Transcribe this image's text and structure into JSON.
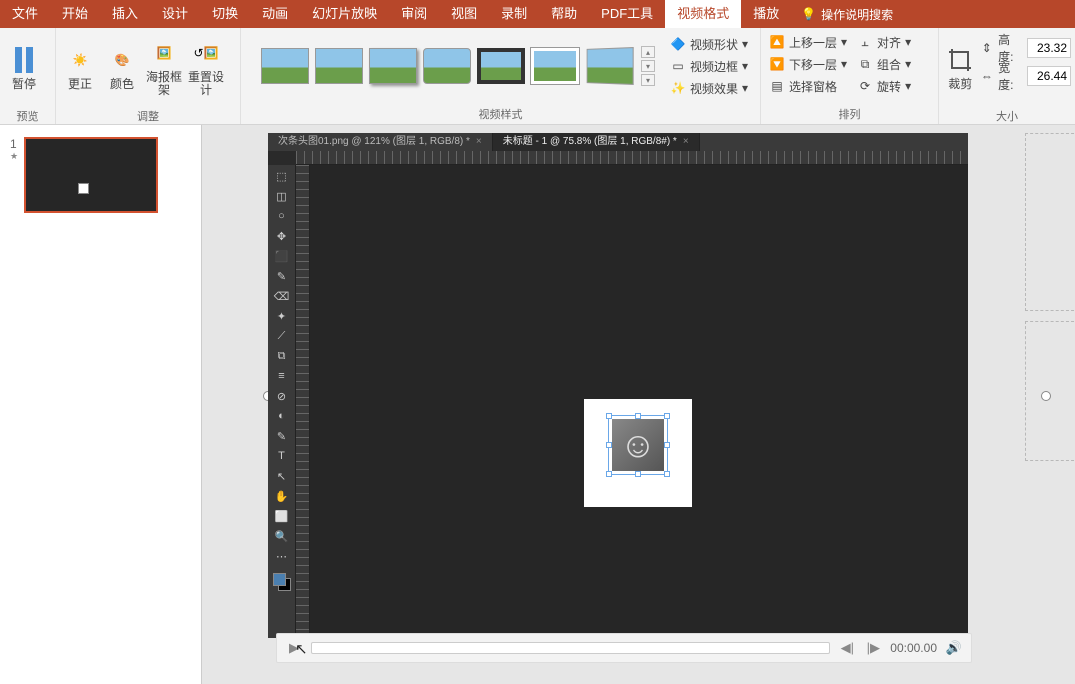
{
  "menu": {
    "items": [
      "文件",
      "开始",
      "插入",
      "设计",
      "切换",
      "动画",
      "幻灯片放映",
      "审阅",
      "视图",
      "录制",
      "帮助",
      "PDF工具",
      "视频格式",
      "播放"
    ],
    "active_index": 12,
    "search_label": "操作说明搜索"
  },
  "ribbon": {
    "preview": {
      "pause": "暂停",
      "label": "预览"
    },
    "adjust": {
      "correct": "更正",
      "color": "颜色",
      "poster": "海报框\n架",
      "reset": "重置设计",
      "label": "调整"
    },
    "styles": {
      "label": "视频样式",
      "shape": "视频形状",
      "border": "视频边框",
      "effects": "视频效果"
    },
    "arrange": {
      "label": "排列",
      "up": "上移一层",
      "down": "下移一层",
      "pane": "选择窗格",
      "align": "对齐",
      "group": "组合",
      "rotate": "旋转"
    },
    "size": {
      "label": "大小",
      "crop": "裁剪",
      "height_label": "高度:",
      "height_value": "23.32",
      "width_label": "宽度:",
      "width_value": "26.44"
    }
  },
  "slide": {
    "number": "1",
    "star": "★"
  },
  "ps": {
    "tab1": "次条头图01.png @ 121% (图层 1, RGB/8) *",
    "tab2": "未标题 - 1 @ 75.8% (图层 1, RGB/8#) *",
    "tools": [
      "⬚",
      "◫",
      "○",
      "✥",
      "⬛",
      "✎",
      "⌫",
      "✦",
      "⟋",
      "⧉",
      "≡",
      "⊘",
      "◐",
      "✎",
      "T",
      "↖",
      "✋",
      "⬜",
      "🔍",
      "⋯"
    ]
  },
  "playbar": {
    "time": "00:00.00"
  }
}
